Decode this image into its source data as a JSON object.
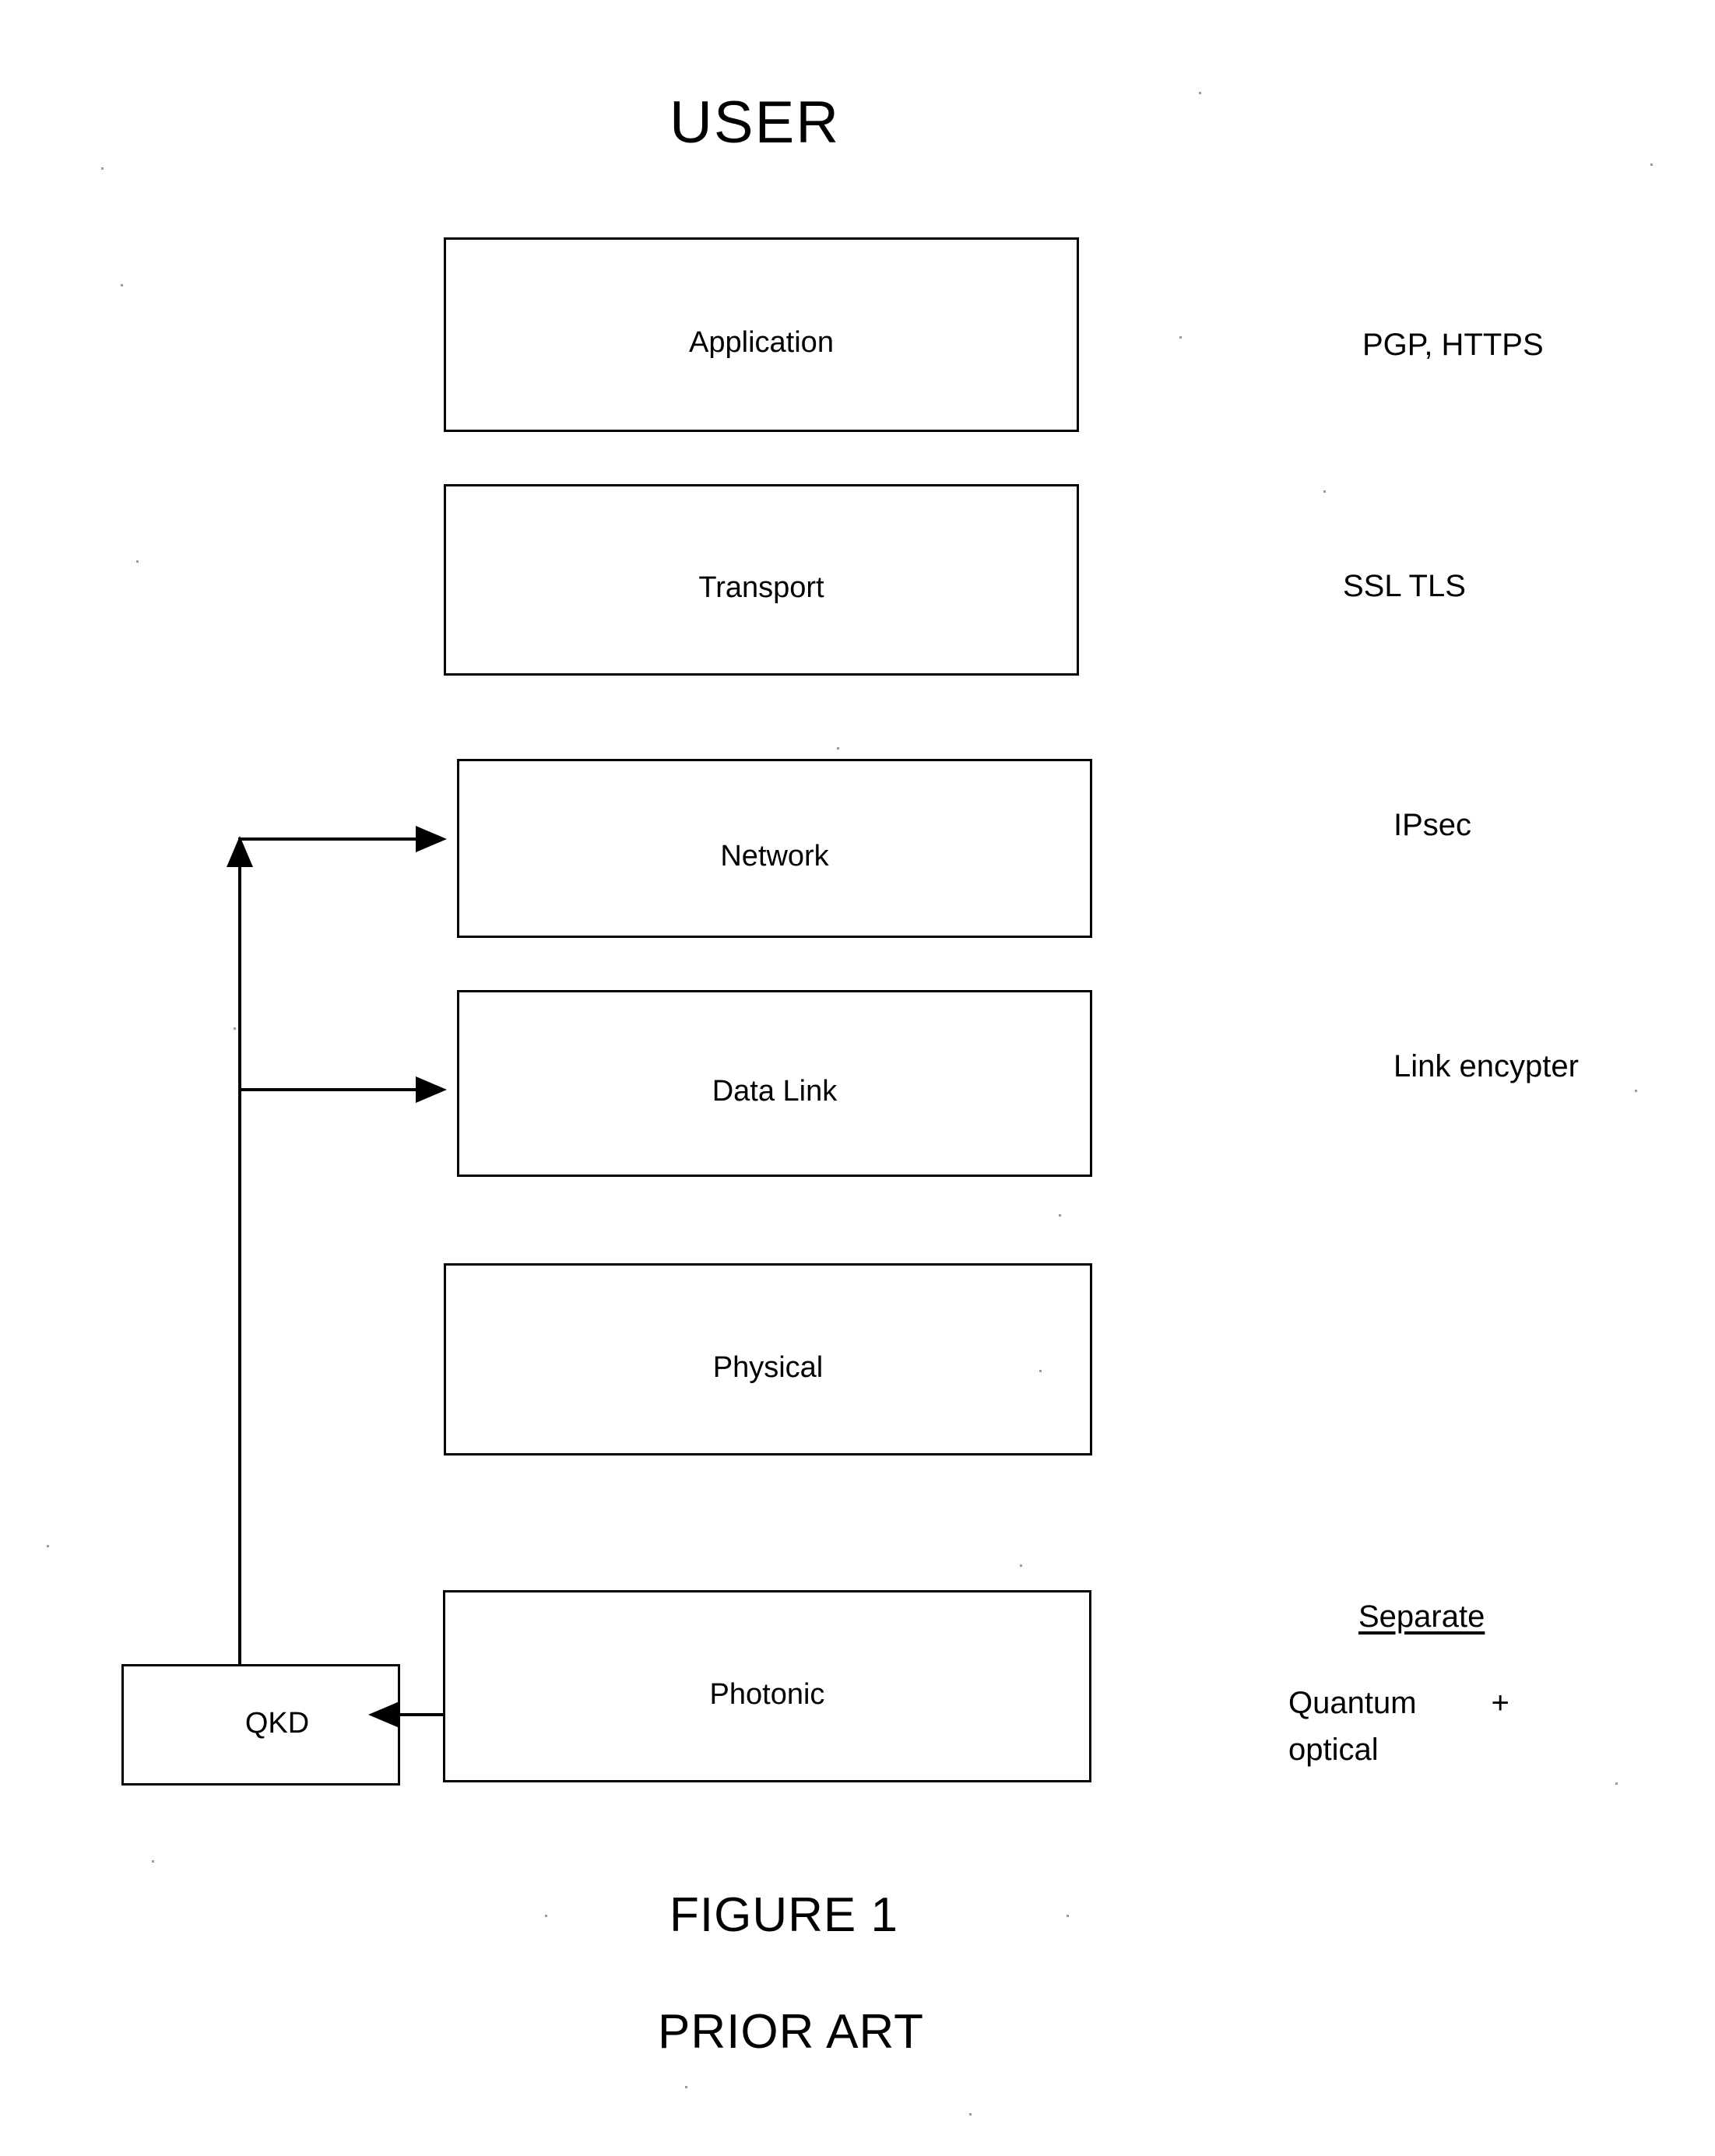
{
  "figure": {
    "top_title": "USER",
    "caption_line1": "FIGURE 1",
    "caption_line2": "PRIOR ART"
  },
  "layers": [
    {
      "id": "application",
      "label": "Application"
    },
    {
      "id": "transport",
      "label": "Transport"
    },
    {
      "id": "network",
      "label": "Network"
    },
    {
      "id": "datalink",
      "label": "Data Link"
    },
    {
      "id": "physical",
      "label": "Physical"
    },
    {
      "id": "photonic",
      "label": "Photonic"
    }
  ],
  "qkd_box": {
    "label": "QKD"
  },
  "annotations": {
    "application": "PGP, HTTPS",
    "transport": "SSL TLS",
    "network": "IPsec",
    "datalink": "Link encypter",
    "separate_heading": "Separate",
    "quantum_word": "Quantum",
    "quantum_plus": "+",
    "optical_word": "optical"
  },
  "style": {
    "ink": "#000000",
    "paper": "#ffffff"
  }
}
